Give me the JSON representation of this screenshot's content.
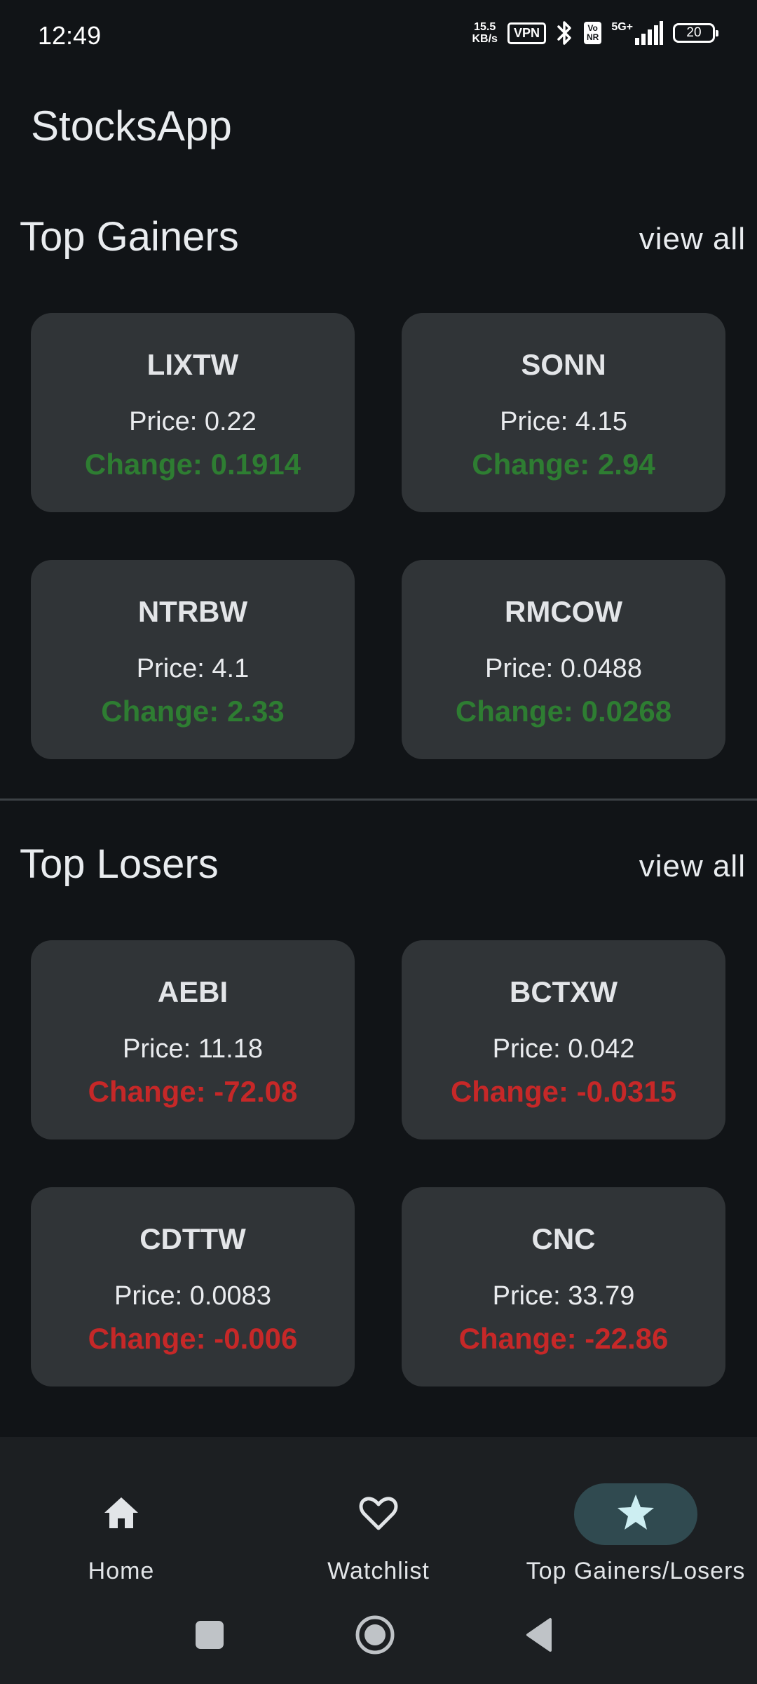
{
  "status_bar": {
    "time": "12:49",
    "net_speed_value": "15.5",
    "net_speed_unit": "KB/s",
    "vpn_label": "VPN",
    "volte_top": "Vo",
    "volte_bottom": "NR",
    "signal_label": "5G+",
    "battery_level": "20"
  },
  "app": {
    "title": "StocksApp"
  },
  "top_gainers": {
    "title": "Top Gainers",
    "view_all": "view all",
    "cards": [
      {
        "symbol": "LIXTW",
        "price": "Price: 0.22",
        "change": "Change: 0.1914"
      },
      {
        "symbol": "SONN",
        "price": "Price: 4.15",
        "change": "Change: 2.94"
      },
      {
        "symbol": "NTRBW",
        "price": "Price: 4.1",
        "change": "Change: 2.33"
      },
      {
        "symbol": "RMCOW",
        "price": "Price: 0.0488",
        "change": "Change: 0.0268"
      }
    ]
  },
  "top_losers": {
    "title": "Top Losers",
    "view_all": "view all",
    "cards": [
      {
        "symbol": "AEBI",
        "price": "Price: 11.18",
        "change": "Change: -72.08"
      },
      {
        "symbol": "BCTXW",
        "price": "Price: 0.042",
        "change": "Change: -0.0315"
      },
      {
        "symbol": "CDTTW",
        "price": "Price: 0.0083",
        "change": "Change: -0.006"
      },
      {
        "symbol": "CNC",
        "price": "Price: 33.79",
        "change": "Change: -22.86"
      }
    ]
  },
  "bottom_nav": {
    "items": [
      {
        "label": "Home",
        "icon": "home-icon",
        "active": false
      },
      {
        "label": "Watchlist",
        "icon": "heart-outline-icon",
        "active": false
      },
      {
        "label": "Top Gainers/Losers",
        "icon": "star-icon",
        "active": true
      }
    ]
  },
  "colors": {
    "background": "#111417",
    "card": "#303437",
    "gain": "#2e7d32",
    "loss": "#c62828",
    "nav_active_pill": "#304a50"
  }
}
